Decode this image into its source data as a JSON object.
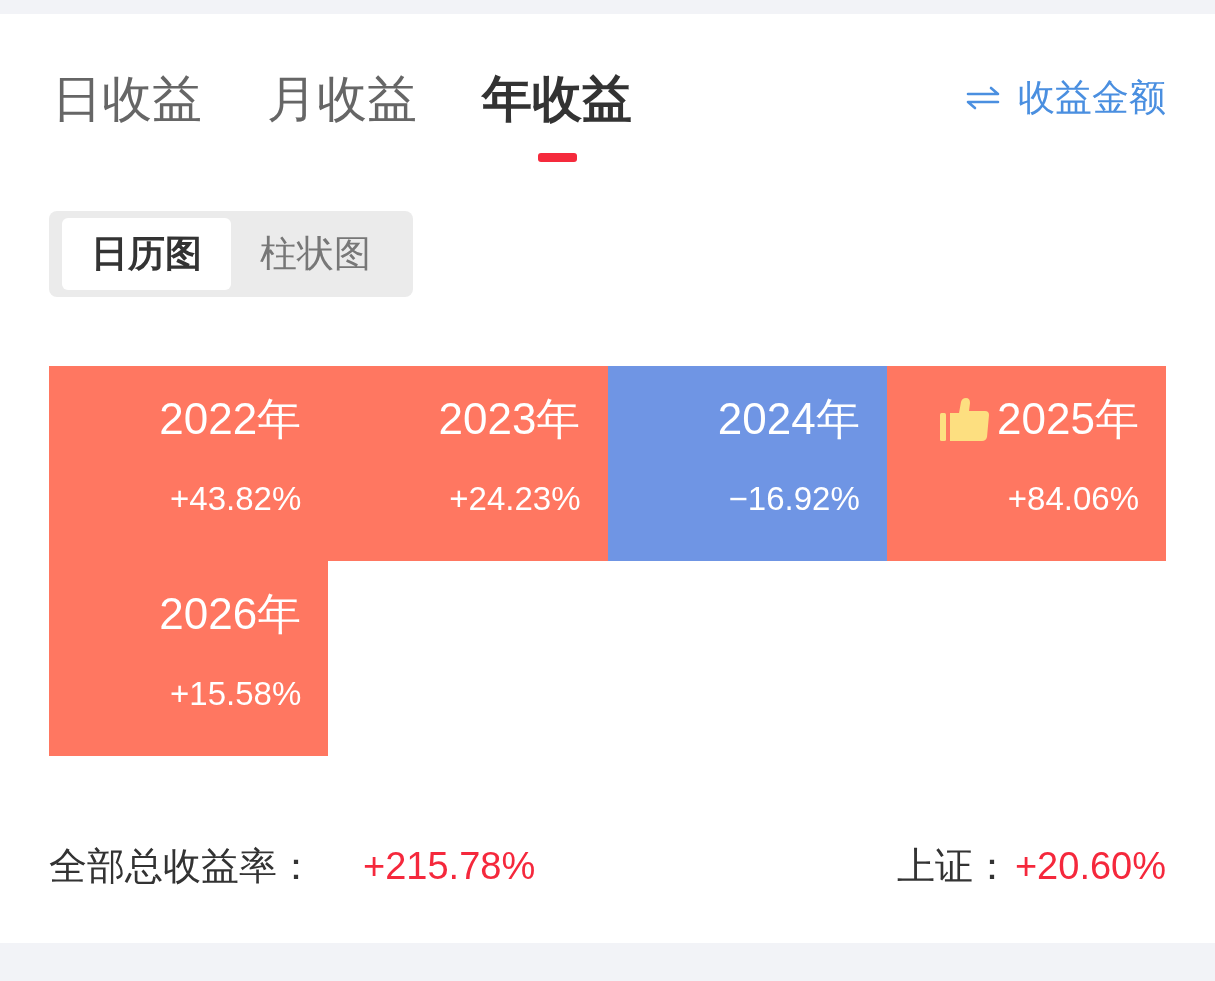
{
  "tabs": [
    {
      "label": "日收益",
      "selected": false
    },
    {
      "label": "月收益",
      "selected": false
    },
    {
      "label": "年收益",
      "selected": true
    }
  ],
  "switch_link": {
    "label": "收益金额"
  },
  "view_toggle": [
    {
      "label": "日历图",
      "selected": true
    },
    {
      "label": "柱状图",
      "selected": false
    }
  ],
  "years": [
    {
      "label": "2022年",
      "return": "+43.82%",
      "color": "#ff7761",
      "thumbs_up": false
    },
    {
      "label": "2023年",
      "return": "+24.23%",
      "color": "#ff7761",
      "thumbs_up": false
    },
    {
      "label": "2024年",
      "return": "−16.92%",
      "color": "#6f95e4",
      "thumbs_up": false
    },
    {
      "label": "2025年",
      "return": "+84.06%",
      "color": "#ff7761",
      "thumbs_up": true
    },
    {
      "label": "2026年",
      "return": "+15.58%",
      "color": "#ff7761",
      "thumbs_up": false
    }
  ],
  "summary": {
    "total_label": "全部总收益率：",
    "total_value": "+215.78%",
    "index_label": "上证：",
    "index_value": "+20.60%"
  }
}
